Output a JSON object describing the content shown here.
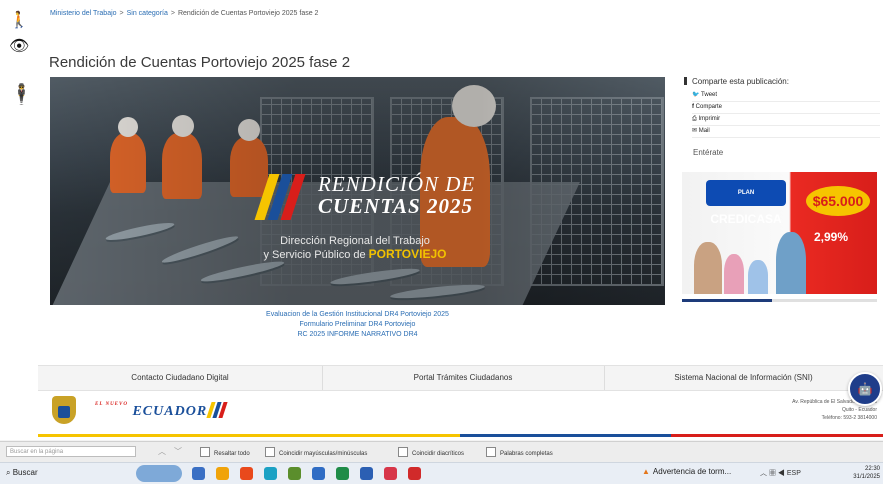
{
  "accessibility_icons": [
    "accessibility-person-icon",
    "eye-icon",
    "accessibility-person-icon"
  ],
  "breadcrumb": {
    "items": [
      "Ministerio del Trabajo",
      "Sin categoría",
      "Rendición de Cuentas Portoviejo 2025 fase 2"
    ],
    "separator": ">"
  },
  "page_title": "Rendición de Cuentas Portoviejo 2025 fase 2",
  "hero": {
    "heading_line1": "RENDICIÓN DE",
    "heading_line2": "CUENTAS 2025",
    "sub_line1": "Dirección Regional del Trabajo",
    "sub_line2": "y Servicio Público de",
    "sub_highlight": "PORTOVIEJO"
  },
  "document_links": [
    "Evaluacion de la Gestión Institucional DR4 Portoviejo 2025",
    "Formulario Preliminar DR4 Portoviejo",
    "RC 2025 INFORME NARRATIVO DR4"
  ],
  "share": {
    "title": "Comparte esta publicación:",
    "buttons": [
      {
        "icon": "twitter-icon",
        "label": "Tweet"
      },
      {
        "icon": "facebook-icon",
        "label": "Comparte"
      },
      {
        "icon": "print-icon",
        "label": "Imprimir"
      },
      {
        "icon": "mail-icon",
        "label": "Mail"
      }
    ]
  },
  "sidebar": {
    "enterate": "Entérate",
    "ad": {
      "brand_top": "PLAN",
      "brand": "CREDICASA",
      "amount": "$65.000",
      "rate": "2,99%"
    }
  },
  "footer_links": [
    "Contacto Ciudadano Digital",
    "Portal Trámites Ciudadanos",
    "Sistema Nacional de Información (SNI)"
  ],
  "footer": {
    "logo_text": "ECUADOR",
    "logo_small": "EL NUEVO",
    "address_line1": "Av. República de El Salvador N34-183",
    "address_line2": "Quito - Ecuador",
    "address_line3": "Teléfono: 593-2 3814000"
  },
  "find_bar": {
    "placeholder": "Buscar en la página",
    "options": [
      "Resaltar todo",
      "Coincidir mayúsculas/minúsculas",
      "Coincidir diacríticos",
      "Palabras completas"
    ]
  },
  "taskbar": {
    "search_label": "Buscar",
    "notification": "Advertencia de torm...",
    "clock_time": "22:30",
    "clock_date": "31/1/2025",
    "lang": "ESP"
  },
  "colors": {
    "link_blue": "#2a6db3",
    "accent_yellow": "#f2c200",
    "ecuador_yellow": "#f6c400",
    "ecuador_blue": "#1a4f9a",
    "ecuador_red": "#d81e1a"
  }
}
